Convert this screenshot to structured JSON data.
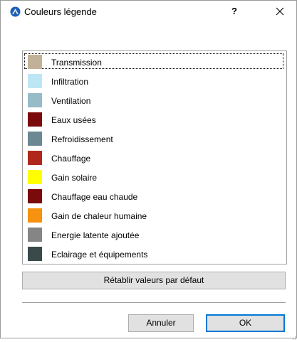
{
  "window": {
    "title": "Couleurs légende",
    "help_label": "?",
    "app_icon": "archicad-icon",
    "close_icon": "close-icon"
  },
  "legend": {
    "items": [
      {
        "label": "Transmission",
        "color": "#c2b199",
        "selected": true
      },
      {
        "label": "Infiltration",
        "color": "#bde6f5",
        "selected": false
      },
      {
        "label": "Ventilation",
        "color": "#95bcc8",
        "selected": false
      },
      {
        "label": "Eaux usées",
        "color": "#7a0a0c",
        "selected": false
      },
      {
        "label": "Refroidissement",
        "color": "#6c8893",
        "selected": false
      },
      {
        "label": "Chauffage",
        "color": "#b0281c",
        "selected": false
      },
      {
        "label": "Gain solaire",
        "color": "#ffff00",
        "selected": false
      },
      {
        "label": "Chauffage eau chaude",
        "color": "#7a0a0c",
        "selected": false
      },
      {
        "label": "Gain de chaleur humaine",
        "color": "#f6920f",
        "selected": false
      },
      {
        "label": "Energie latente ajoutée",
        "color": "#858585",
        "selected": false
      },
      {
        "label": "Eclairage et équipements",
        "color": "#3a4a4a",
        "selected": false
      }
    ]
  },
  "buttons": {
    "reset_label": "Rétablir valeurs par défaut",
    "cancel_label": "Annuler",
    "ok_label": "OK"
  },
  "colors": {
    "ok_border": "#0078d7",
    "button_face": "#e1e1e1"
  }
}
